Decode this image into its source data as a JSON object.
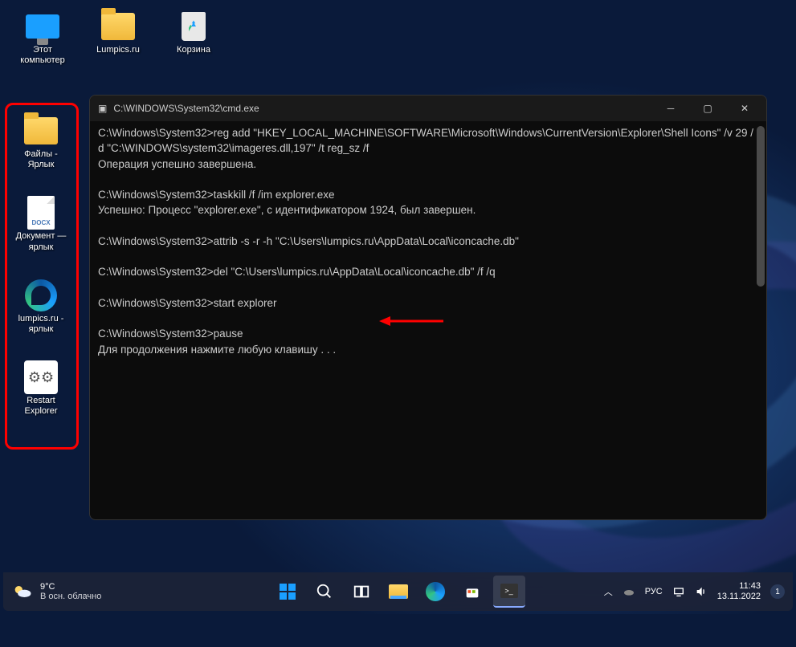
{
  "desktop_icons_row": [
    {
      "name": "pc",
      "label": "Этот\nкомпьютер"
    },
    {
      "name": "lumpics-folder",
      "label": "Lumpics.ru"
    },
    {
      "name": "recycle-bin",
      "label": "Корзина"
    }
  ],
  "desktop_icons_col": [
    {
      "name": "files-shortcut",
      "label": "Файлы -\nЯрлык"
    },
    {
      "name": "doc-shortcut",
      "label": "Документ —\nярлык"
    },
    {
      "name": "edge-shortcut",
      "label": "lumpics.ru -\nярлык"
    },
    {
      "name": "restart-bat",
      "label": "Restart\nExplorer"
    }
  ],
  "cmd": {
    "title": "C:\\WINDOWS\\System32\\cmd.exe",
    "lines": "C:\\Windows\\System32>reg add \"HKEY_LOCAL_MACHINE\\SOFTWARE\\Microsoft\\Windows\\CurrentVersion\\Explorer\\Shell Icons\" /v 29 /d \"C:\\WINDOWS\\system32\\imageres.dll,197\" /t reg_sz /f\nОперация успешно завершена.\n\nC:\\Windows\\System32>taskkill /f /im explorer.exe\nУспешно: Процесс \"explorer.exe\", с идентификатором 1924, был завершен.\n\nC:\\Windows\\System32>attrib -s -r -h \"C:\\Users\\lumpics.ru\\AppData\\Local\\iconcache.db\"\n\nC:\\Windows\\System32>del \"C:\\Users\\lumpics.ru\\AppData\\Local\\iconcache.db\" /f /q\n\nC:\\Windows\\System32>start explorer\n\nC:\\Windows\\System32>pause\nДля продолжения нажмите любую клавишу . . ."
  },
  "taskbar": {
    "weather_temp": "9°C",
    "weather_desc": "В осн. облачно",
    "lang": "РУС",
    "time": "11:43",
    "date": "13.11.2022",
    "notif": "1"
  }
}
